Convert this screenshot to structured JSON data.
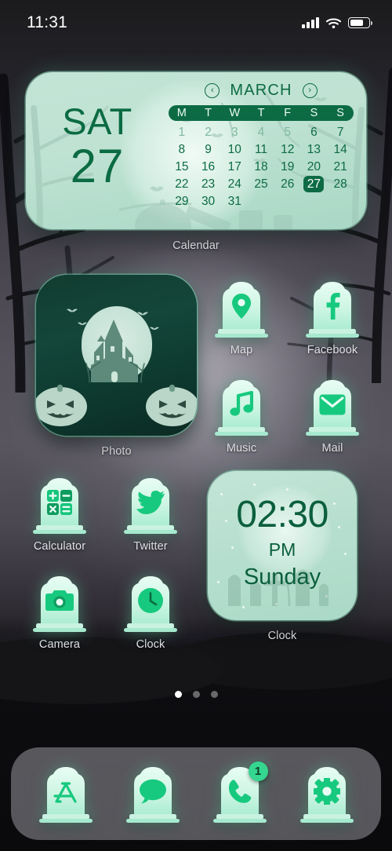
{
  "status_bar": {
    "time": "11:31",
    "signal_icon": "cellular-signal-icon",
    "wifi_icon": "wifi-icon",
    "battery_icon": "battery-icon"
  },
  "theme": {
    "accent_green": "#0d6b44",
    "mint": "#b7dfcf",
    "glyph_green": "#17c97e",
    "label_color": "#e9e9ee"
  },
  "calendar_widget": {
    "label": "Calendar",
    "weekday": "SAT",
    "day_number": "27",
    "month": "MARCH",
    "prev_arrow": "‹",
    "next_arrow": "›",
    "day_headers": [
      "M",
      "T",
      "W",
      "T",
      "F",
      "S",
      "S"
    ],
    "days": [
      {
        "n": "1",
        "dim": true
      },
      {
        "n": "2",
        "dim": true
      },
      {
        "n": "3",
        "dim": true
      },
      {
        "n": "4",
        "dim": true
      },
      {
        "n": "5",
        "dim": true
      },
      {
        "n": "6",
        "dim": false
      },
      {
        "n": "7",
        "dim": false
      },
      {
        "n": "8"
      },
      {
        "n": "9"
      },
      {
        "n": "10"
      },
      {
        "n": "11"
      },
      {
        "n": "12"
      },
      {
        "n": "13"
      },
      {
        "n": "14"
      },
      {
        "n": "15"
      },
      {
        "n": "16"
      },
      {
        "n": "17"
      },
      {
        "n": "18"
      },
      {
        "n": "19"
      },
      {
        "n": "20"
      },
      {
        "n": "21"
      },
      {
        "n": "22"
      },
      {
        "n": "23"
      },
      {
        "n": "24"
      },
      {
        "n": "25"
      },
      {
        "n": "26"
      },
      {
        "n": "27",
        "today": true
      },
      {
        "n": "28"
      },
      {
        "n": "29"
      },
      {
        "n": "30"
      },
      {
        "n": "31"
      }
    ]
  },
  "photo_widget": {
    "label": "Photo",
    "scene": "haunted-house-moon-pumpkins"
  },
  "clock_widget": {
    "label": "Clock",
    "time": "02:30",
    "meridiem": "PM",
    "day": "Sunday"
  },
  "apps": [
    {
      "name": "Map",
      "icon": "map-pin-icon"
    },
    {
      "name": "Facebook",
      "icon": "facebook-icon"
    },
    {
      "name": "Music",
      "icon": "music-note-icon"
    },
    {
      "name": "Mail",
      "icon": "envelope-icon"
    },
    {
      "name": "Calculator",
      "icon": "calculator-icon"
    },
    {
      "name": "Twitter",
      "icon": "twitter-bird-icon"
    },
    {
      "name": "Camera",
      "icon": "camera-icon"
    },
    {
      "name": "Clock",
      "icon": "analog-clock-icon"
    }
  ],
  "page_indicator": {
    "total": 3,
    "active": 1
  },
  "dock": [
    {
      "name": "App Store",
      "icon": "app-store-icon",
      "badge": null
    },
    {
      "name": "Messages",
      "icon": "message-bubble-icon",
      "badge": null
    },
    {
      "name": "Phone",
      "icon": "phone-handset-icon",
      "badge": "1"
    },
    {
      "name": "Settings",
      "icon": "gear-icon",
      "badge": null
    }
  ]
}
